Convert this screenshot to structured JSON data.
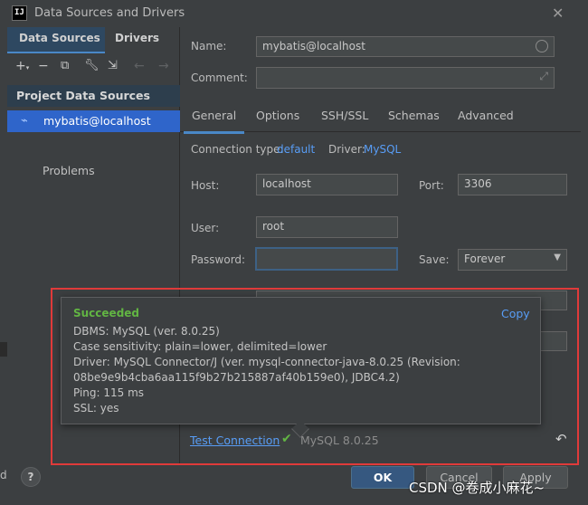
{
  "window": {
    "title": "Data Sources and Drivers",
    "app_icon_text": "IJ"
  },
  "left": {
    "tabs": [
      "Data Sources",
      "Drivers"
    ],
    "toolbar_icons": [
      "add-icon",
      "remove-icon",
      "duplicate-icon",
      "wrench-icon",
      "import-icon",
      "back-arrow-icon",
      "forward-arrow-icon"
    ],
    "section_header": "Project Data Sources",
    "selected_item": "mybatis@localhost",
    "problems": "Problems"
  },
  "form": {
    "name_label": "Name:",
    "name_value": "mybatis@localhost",
    "comment_label": "Comment:",
    "comment_value": "",
    "tabs": [
      "General",
      "Options",
      "SSH/SSL",
      "Schemas",
      "Advanced"
    ],
    "connection_type_label": "Connection type:",
    "connection_type_value": "default",
    "driver_label": "Driver:",
    "driver_value": "MySQL",
    "host_label": "Host:",
    "host_value": "localhost",
    "port_label": "Port:",
    "port_value": "3306",
    "user_label": "User:",
    "user_value": "root",
    "password_label": "Password:",
    "password_value": "",
    "save_label": "Save:",
    "save_value": "Forever"
  },
  "popup": {
    "title": "Succeeded",
    "copy": "Copy",
    "lines": [
      "DBMS: MySQL (ver. 8.0.25)",
      "Case sensitivity: plain=lower, delimited=lower",
      "Driver: MySQL Connector/J (ver. mysql-connector-java-8.0.25 (Revision:",
      "08be9e9b4cba6aa115f9b27b215887af40b159e0), JDBC4.2)",
      "Ping: 115 ms",
      "SSL: yes"
    ]
  },
  "test": {
    "link": "Test Connection",
    "result": "MySQL 8.0.25"
  },
  "buttons": {
    "help": "?",
    "ok": "OK",
    "cancel": "Cancel",
    "apply": "Apply"
  },
  "misc": {
    "stray_letter": "d",
    "watermark": "CSDN @卷成小麻花~"
  },
  "colors": {
    "accent": "#589df6",
    "success": "#62b543",
    "highlight_frame": "#e03a3a",
    "selection": "#2f65ca"
  }
}
